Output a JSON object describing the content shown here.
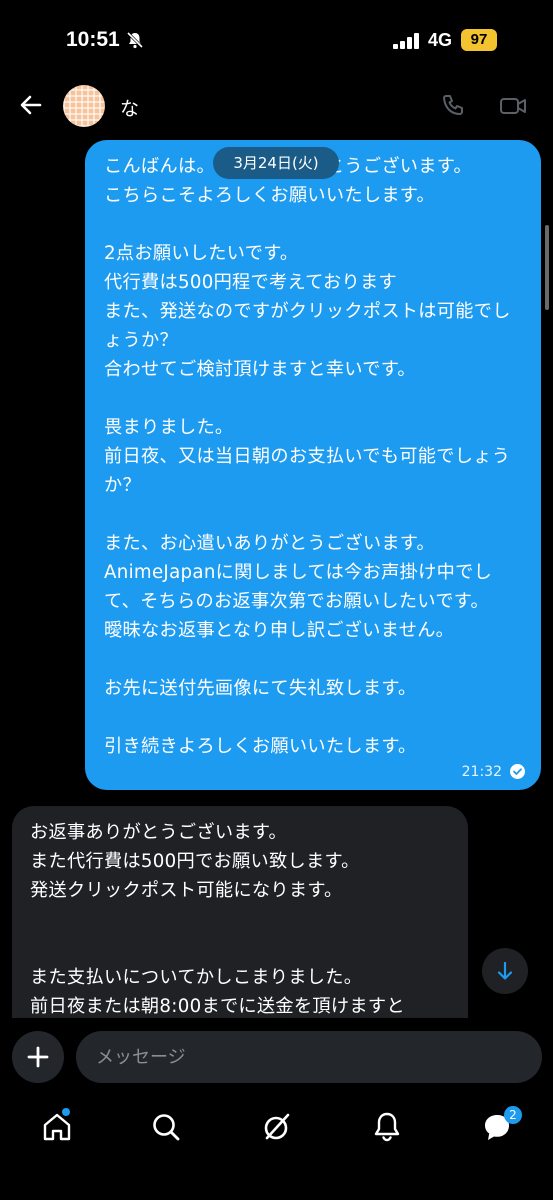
{
  "status_bar": {
    "time": "10:51",
    "network": "4G",
    "battery": "97"
  },
  "header": {
    "contact_name": "な"
  },
  "date_chip": "3月24日(火)",
  "messages": {
    "outgoing": {
      "text": "こんばんは。ご返信ありがとうございます。\nこちらこそよろしくお願いいたします。\n\n2点お願いしたいです。\n代行費は500円程で考えております\nまた、発送なのですがクリックポストは可能でしょうか？\n合わせてご検討頂けますと幸いです。\n\n畏まりました。\n前日夜、又は当日朝のお支払いでも可能でしょうか？\n\nまた、お心遣いありがとうございます。\nAnimeJapanに関しましては今お声掛け中でして、そちらのお返事次第でお願いしたいです。\n曖昧なお返事となり申し訳ございません。\n\nお先に送付先画像にて失礼致します。\n\n引き続きよろしくお願いいたします。",
      "time": "21:32"
    },
    "incoming": {
      "text": "お返事ありがとうございます。\nまた代行費は500円でお願い致します。\n発送クリックポスト可能になります。\n\n\nまた支払いについてかしこまりました。\n前日夜または朝8:00までに送金を頂けますと"
    }
  },
  "composer": {
    "placeholder": "メッセージ"
  },
  "tabbar": {
    "messages_badge": "2"
  },
  "colors": {
    "accent": "#1d9bf0",
    "incoming_bubble": "#1f2124",
    "battery": "#f4c430"
  }
}
